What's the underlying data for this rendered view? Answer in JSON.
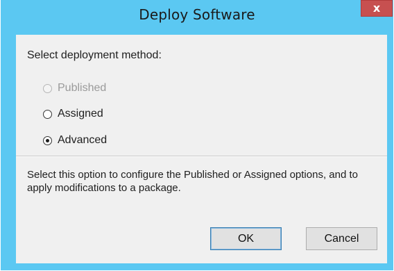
{
  "window": {
    "title": "Deploy Software",
    "close_glyph": "x"
  },
  "dialog": {
    "prompt": "Select deployment method:",
    "options": [
      {
        "label": "Published",
        "state": "disabled",
        "selected": false
      },
      {
        "label": "Assigned",
        "state": "enabled",
        "selected": false
      },
      {
        "label": "Advanced",
        "state": "enabled",
        "selected": true
      }
    ],
    "description": "Select this option to configure the Published or Assigned options, and to apply modifications to a package."
  },
  "buttons": {
    "ok_label": "OK",
    "cancel_label": "Cancel"
  },
  "colors": {
    "frame": "#5bc8f2",
    "close_button": "#c75050",
    "client_background": "#f0f0f0"
  }
}
